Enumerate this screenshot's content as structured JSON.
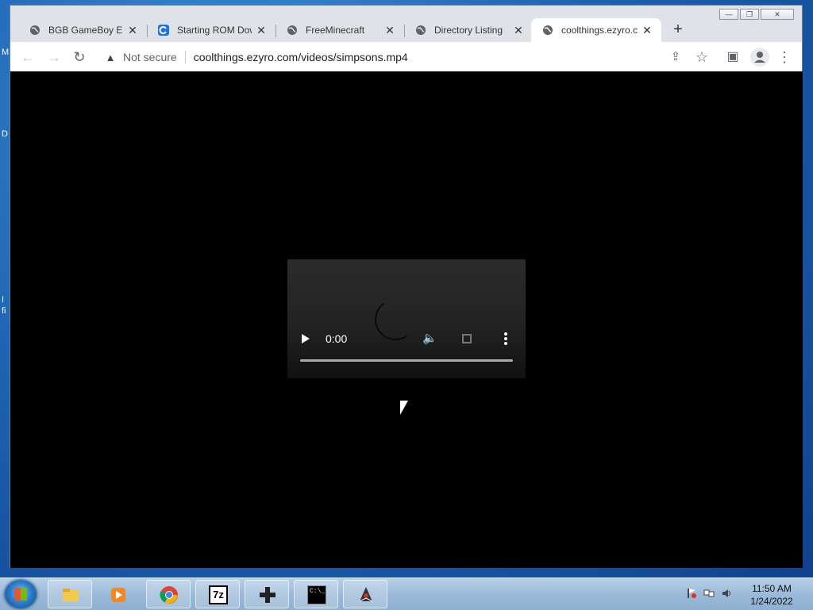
{
  "desktop": {
    "edge_letters": [
      "M",
      "D",
      "I",
      "fi"
    ]
  },
  "window": {
    "minimize_label": "—",
    "restore_label": "❐",
    "close_label": "✕"
  },
  "tabs": [
    {
      "title": "BGB GameBoy Em",
      "close": "✕",
      "favicon": "globe-icon"
    },
    {
      "title": "Starting ROM Dow",
      "close": "✕",
      "favicon": "refresh-site-icon"
    },
    {
      "title": "FreeMinecraft",
      "close": "✕",
      "favicon": "globe-icon"
    },
    {
      "title": "Directory Listing",
      "close": "✕",
      "favicon": "globe-icon"
    },
    {
      "title": "coolthings.ezyro.c",
      "close": "✕",
      "favicon": "globe-icon",
      "active": true
    }
  ],
  "new_tab_label": "+",
  "toolbar": {
    "back": "←",
    "forward": "→",
    "reload": "↻",
    "security_icon": "▲",
    "security_text": "Not secure",
    "url": "coolthings.ezyro.com/videos/simpsons.mp4",
    "share": "⇪",
    "bookmark": "☆",
    "sidepanel": "▣",
    "menu": "⋮"
  },
  "video": {
    "time": "0:00",
    "volume": "🔈"
  },
  "taskbar": {
    "apps": [
      "file-explorer-icon",
      "media-player-icon",
      "chrome-icon",
      "7zip-icon",
      "gamepad-icon",
      "cmd-icon",
      "java-icon"
    ],
    "sevenzip_label": "7z",
    "cmd_label": "C:\\_",
    "clock_time": "11:50 AM",
    "clock_date": "1/24/2022",
    "tray": [
      "flag-icon",
      "network-icon",
      "volume-icon"
    ]
  },
  "colors": {
    "accent": "#1a73e8",
    "page_bg": "#000000",
    "tabstrip_bg": "#dfe3e8"
  }
}
